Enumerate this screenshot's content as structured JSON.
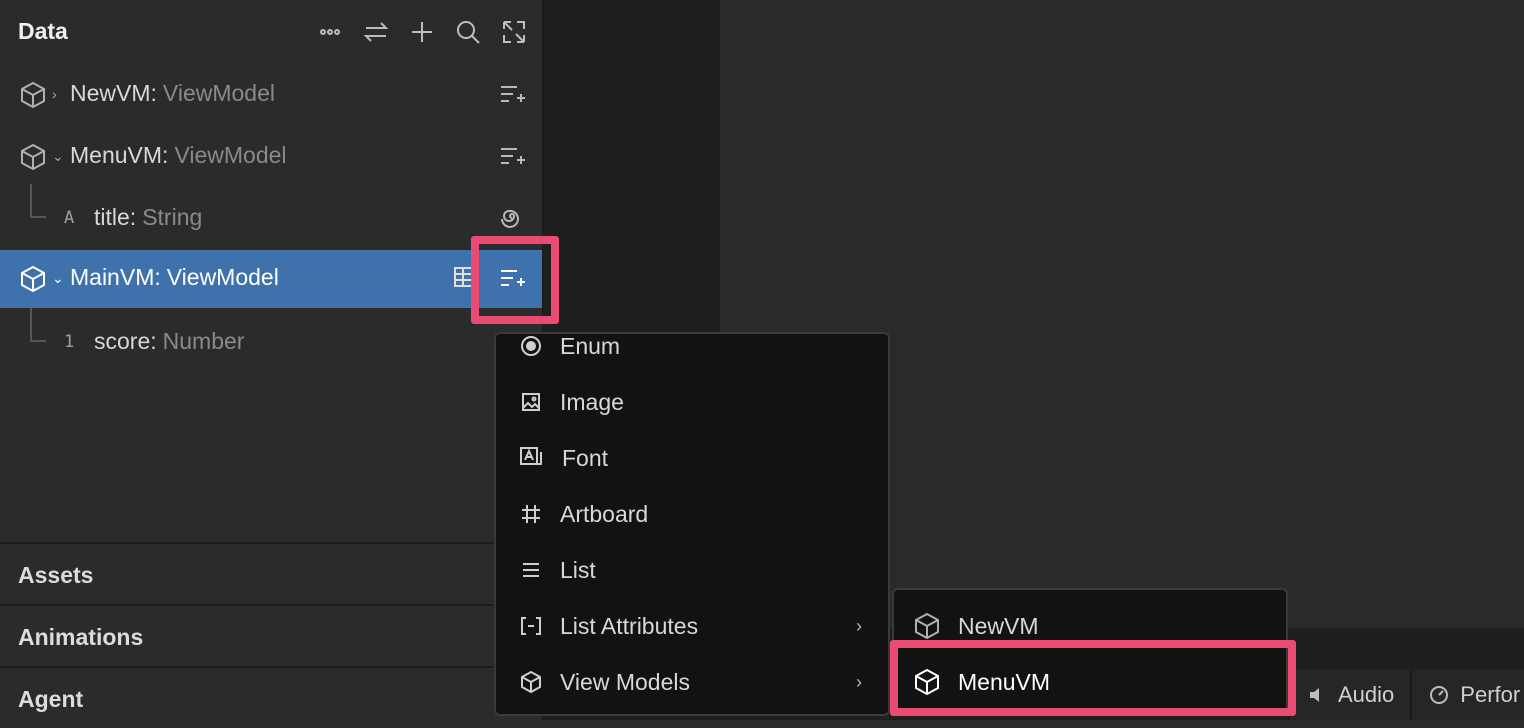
{
  "panel": {
    "title": "Data",
    "header_icons": [
      "more-icon",
      "swap-icon",
      "plus-icon",
      "search-icon",
      "expand-icon"
    ]
  },
  "tree": [
    {
      "name": "NewVM:",
      "type": "ViewModel",
      "expanded": false
    },
    {
      "name": "MenuVM:",
      "type": "ViewModel",
      "expanded": true
    },
    {
      "glyph": "A",
      "name": "title:",
      "type": "String",
      "child": true
    },
    {
      "name": "MainVM:",
      "type": "ViewModel",
      "expanded": true,
      "selected": true
    },
    {
      "glyph": "1",
      "name": "score:",
      "type": "Number",
      "child": true
    }
  ],
  "sections": [
    "Assets",
    "Animations",
    "Agent"
  ],
  "menu": {
    "items": [
      {
        "label": "Enum",
        "icon": "radio-icon"
      },
      {
        "label": "Image",
        "icon": "image-icon"
      },
      {
        "label": "Font",
        "icon": "font-icon"
      },
      {
        "label": "Artboard",
        "icon": "artboard-icon"
      },
      {
        "label": "List",
        "icon": "list-icon"
      },
      {
        "label": "List Attributes",
        "icon": "bracket-icon",
        "submenu": true
      },
      {
        "label": "View Models",
        "icon": "cube-icon",
        "submenu": true
      }
    ]
  },
  "submenu": {
    "items": [
      {
        "label": "NewVM"
      },
      {
        "label": "MenuVM",
        "active": true
      }
    ]
  },
  "bottom_tabs": [
    {
      "label": "Audio"
    },
    {
      "label": "Perfor"
    }
  ],
  "colors": {
    "selection": "#3f72ad",
    "highlight": "#ea4b72"
  }
}
